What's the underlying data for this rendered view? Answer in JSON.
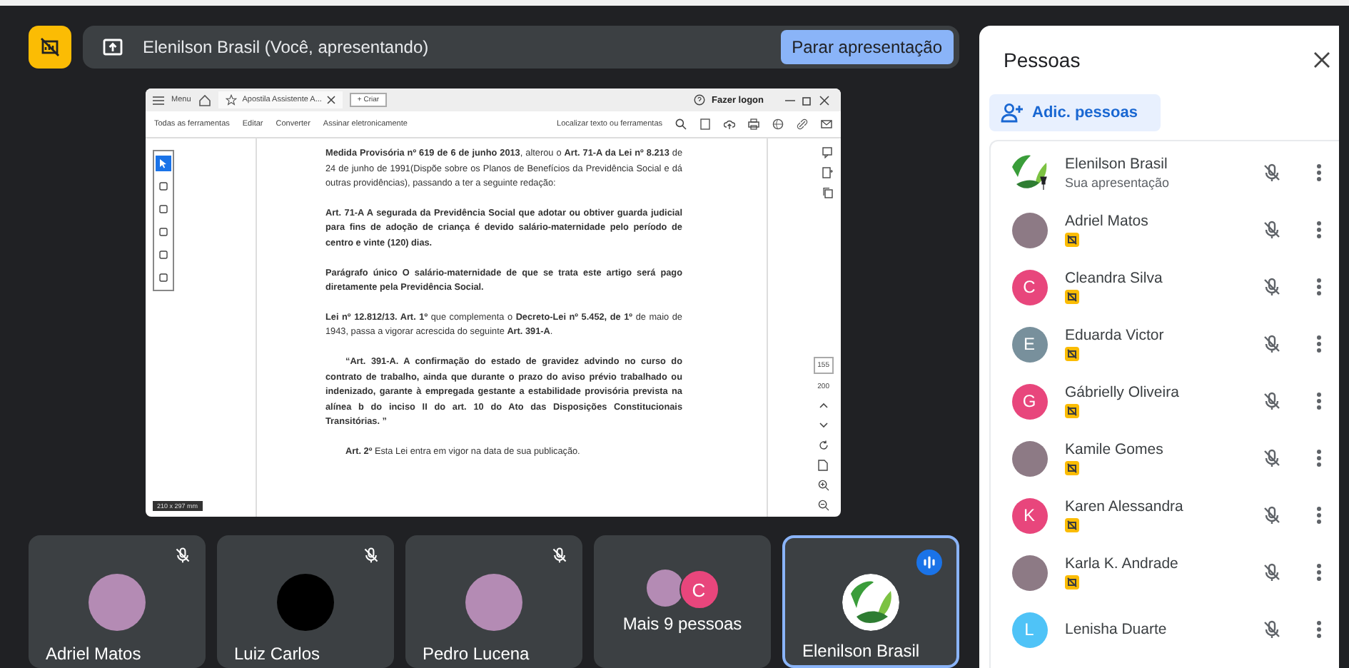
{
  "presentation_bar": {
    "title": "Elenilson Brasil (Você, apresentando)",
    "stop_button": "Parar apresentação"
  },
  "shared_window": {
    "menu": "Menu",
    "tab_title": "Apostila Assistente A...",
    "new_tab": "+ Criar",
    "login": "Fazer logon",
    "tools": [
      "Todas as ferramentas",
      "Editar",
      "Converter",
      "Assinar eletronicamente"
    ],
    "search_label": "Localizar texto ou ferramentas",
    "tool_panel": [
      {
        "selected": true
      },
      {
        "selected": false
      },
      {
        "selected": false
      },
      {
        "selected": false
      },
      {
        "selected": false
      },
      {
        "selected": false
      }
    ],
    "paragraphs": [
      {
        "text": "**Medida Provisória nº 619 de 6 de junho 2013**, alterou o **Art. 71-A da Lei nº 8.213** de 24 de junho de 1991(Dispõe sobre os Planos de Benefícios da Previdência Social e dá outras providências), passando a ter a seguinte redação:",
        "bold": false,
        "indent": false
      },
      {
        "text": "Art. 71-A   A segurada da Previdência Social que adotar ou obtiver guarda judicial para fins de adoção de criança é devido salário-maternidade pelo período de centro e vinte (120) dias.",
        "bold": true,
        "indent": false
      },
      {
        "text": "Parágrafo único   O salário-maternidade de que se trata este artigo será pago diretamente pela Previdência Social.",
        "bold": true,
        "indent": false
      },
      {
        "text": "**Lei nº 12.812/13. Art. 1º** que complementa o **Decreto-Lei nº 5.452, de 1º** de maio de 1943, passa a vigorar acrescida do seguinte **Art. 391-A**.",
        "bold": false,
        "indent": false
      },
      {
        "text": "“Art. 391-A. A confirmação do estado de gravidez advindo no curso do contrato de trabalho, ainda que durante o prazo do aviso prévio trabalhado ou indenizado, garante à empregada gestante a estabilidade provisória prevista na alínea b do inciso II do art. 10 do Ato das Disposições Constitucionais Transitórias. ”",
        "bold": true,
        "indent": true
      },
      {
        "text": "**Art. 2º** Esta Lei entra em vigor na data de sua publicação.",
        "bold": false,
        "indent": true
      }
    ],
    "page_numbers": [
      "155",
      "200"
    ],
    "page_size": "210 x 297 mm"
  },
  "tiles": [
    {
      "kind": "person",
      "name": "Adriel Matos",
      "avatar": {
        "kind": "photo"
      },
      "muted": true,
      "speaking": false
    },
    {
      "kind": "person",
      "name": "Luiz Carlos",
      "avatar": {
        "kind": "dark"
      },
      "muted": true,
      "speaking": false
    },
    {
      "kind": "person",
      "name": "Pedro Lucena",
      "avatar": {
        "kind": "photo"
      },
      "muted": true,
      "speaking": false
    },
    {
      "kind": "overflow",
      "name": "Mais 9 pessoas",
      "letter": "C",
      "color": "#e8467c"
    },
    {
      "kind": "person",
      "name": "Elenilson Brasil",
      "avatar": {
        "kind": "logo"
      },
      "muted": false,
      "speaking": true
    }
  ],
  "people_panel": {
    "title": "Pessoas",
    "add_button": "Adic. pessoas",
    "participants": [
      {
        "name": "Elenilson Brasil",
        "subtitle": "Sua apresentação",
        "avatar": {
          "kind": "logo"
        },
        "presenter_badge": false,
        "muted": true
      },
      {
        "name": "Adriel Matos",
        "avatar": {
          "kind": "photo"
        },
        "presenter_badge": true,
        "muted": true
      },
      {
        "name": "Cleandra Silva",
        "avatar": {
          "kind": "letter",
          "letter": "C",
          "color": "#e8467c"
        },
        "presenter_badge": true,
        "muted": true
      },
      {
        "name": "Eduarda Victor",
        "avatar": {
          "kind": "letter",
          "letter": "E",
          "color": "#78909c"
        },
        "presenter_badge": true,
        "muted": true
      },
      {
        "name": "Gábrielly Oliveira",
        "avatar": {
          "kind": "letter",
          "letter": "G",
          "color": "#e8467c"
        },
        "presenter_badge": true,
        "muted": true
      },
      {
        "name": "Kamile Gomes",
        "avatar": {
          "kind": "photo"
        },
        "presenter_badge": true,
        "muted": true
      },
      {
        "name": "Karen Alessandra",
        "avatar": {
          "kind": "letter",
          "letter": "K",
          "color": "#e8467c"
        },
        "presenter_badge": true,
        "muted": true
      },
      {
        "name": "Karla K. Andrade",
        "avatar": {
          "kind": "photo"
        },
        "presenter_badge": true,
        "muted": true
      },
      {
        "name": "Lenisha Duarte",
        "avatar": {
          "kind": "letter",
          "letter": "L",
          "color": "#4fc3f7"
        },
        "presenter_badge": false,
        "muted": true
      }
    ]
  }
}
